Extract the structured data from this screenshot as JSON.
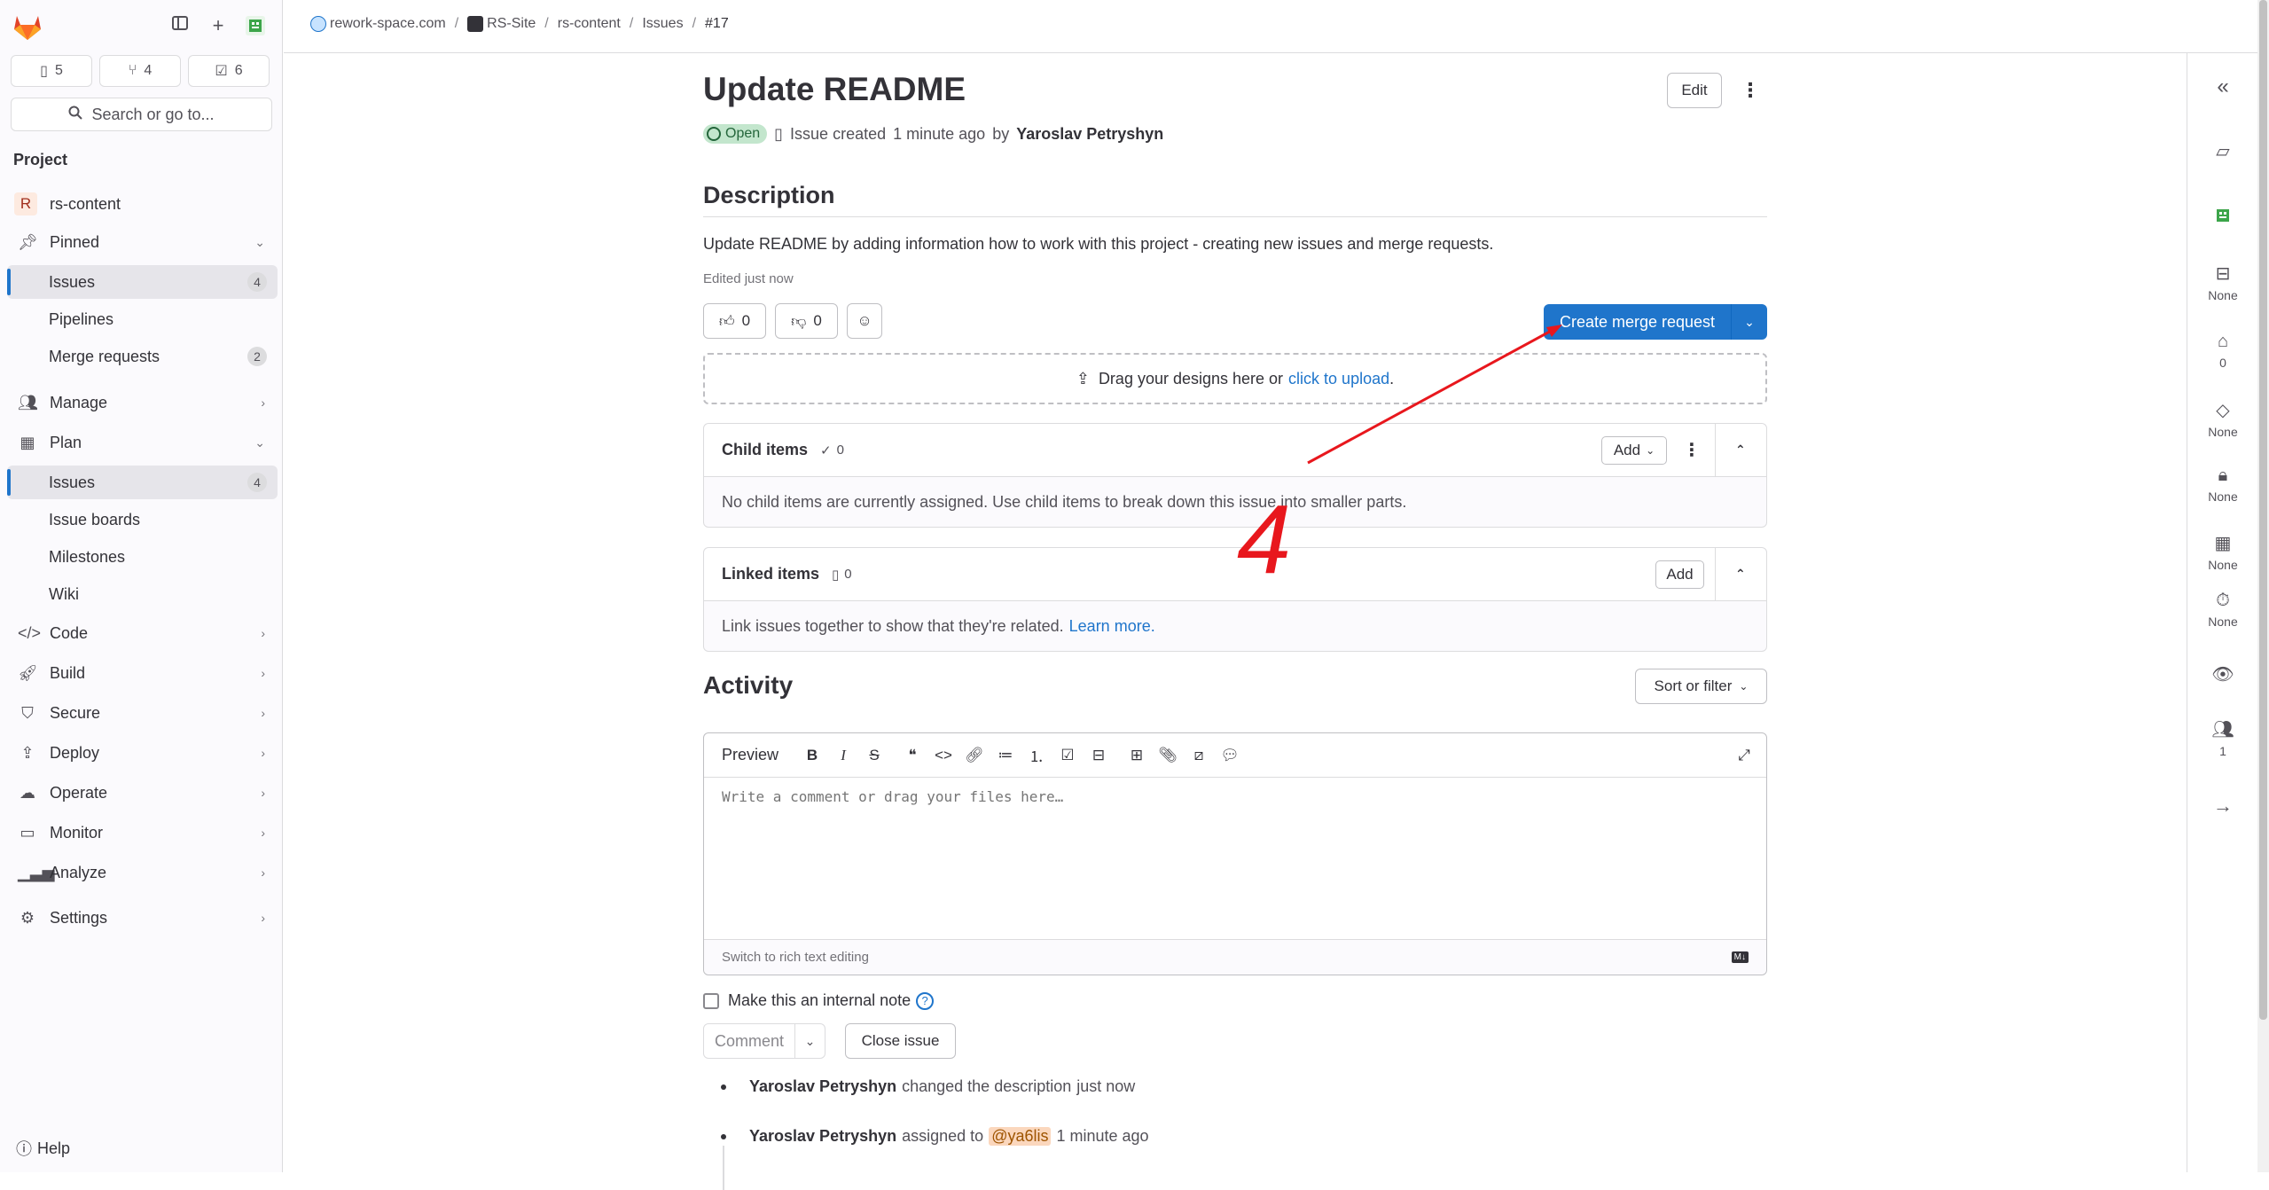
{
  "sidebar": {
    "counts": [
      {
        "icon": "issues-icon",
        "value": "5"
      },
      {
        "icon": "merge-request-icon",
        "value": "4"
      },
      {
        "icon": "todo-icon",
        "value": "6"
      }
    ],
    "search_label": "Search or go to...",
    "section_title": "Project",
    "project_avatar": "R",
    "project_name": "rs-content",
    "pinned": "Pinned",
    "pinned_items": [
      {
        "label": "Issues",
        "badge": "4"
      },
      {
        "label": "Pipelines"
      },
      {
        "label": "Merge requests",
        "badge": "2"
      }
    ],
    "manage": "Manage",
    "plan": "Plan",
    "plan_items": [
      {
        "label": "Issues",
        "badge": "4"
      },
      {
        "label": "Issue boards"
      },
      {
        "label": "Milestones"
      },
      {
        "label": "Wiki"
      }
    ],
    "groups": [
      "Code",
      "Build",
      "Secure",
      "Deploy",
      "Operate",
      "Monitor",
      "Analyze"
    ],
    "settings": "Settings",
    "help": "Help"
  },
  "breadcrumbs": [
    "rework-space.com",
    "RS-Site",
    "rs-content",
    "Issues",
    "#17"
  ],
  "issue": {
    "title": "Update README",
    "edit_label": "Edit",
    "status": "Open",
    "meta_prefix": "Issue created",
    "meta_time": "1 minute ago",
    "meta_by": "by",
    "author": "Yaroslav Petryshyn",
    "description_heading": "Description",
    "description": "Update README by adding information how to work with this project - creating new issues and merge requests.",
    "edited": "Edited just now",
    "thumbs_up": "0",
    "thumbs_down": "0",
    "create_mr": "Create merge request",
    "drop_text": "Drag your designs here or",
    "drop_link": "click to upload",
    "drop_end": "."
  },
  "child_items": {
    "title": "Child items",
    "count": "0",
    "add": "Add",
    "empty": "No child items are currently assigned. Use child items to break down this issue into smaller parts."
  },
  "linked_items": {
    "title": "Linked items",
    "count": "0",
    "add": "Add",
    "text": "Link issues together to show that they're related.",
    "link": "Learn more."
  },
  "activity": {
    "heading": "Activity",
    "sort": "Sort or filter",
    "preview": "Preview",
    "placeholder": "Write a comment or drag your files here…",
    "switch_editor": "Switch to rich text editing",
    "markdown_badge": "M↓",
    "internal_note": "Make this an internal note",
    "comment": "Comment",
    "close_issue": "Close issue",
    "items": [
      {
        "user": "Yaroslav Petryshyn",
        "action": "changed the description",
        "mention": "",
        "time": "just now"
      },
      {
        "user": "Yaroslav Petryshyn",
        "action": "assigned to",
        "mention": "@ya6lis",
        "time": "1 minute ago"
      }
    ]
  },
  "right_sidebar": {
    "values": [
      "None",
      "0",
      "None",
      "None",
      "None",
      "None",
      "1"
    ]
  },
  "annotation": {
    "label": "4",
    "color": "#e8171d"
  }
}
